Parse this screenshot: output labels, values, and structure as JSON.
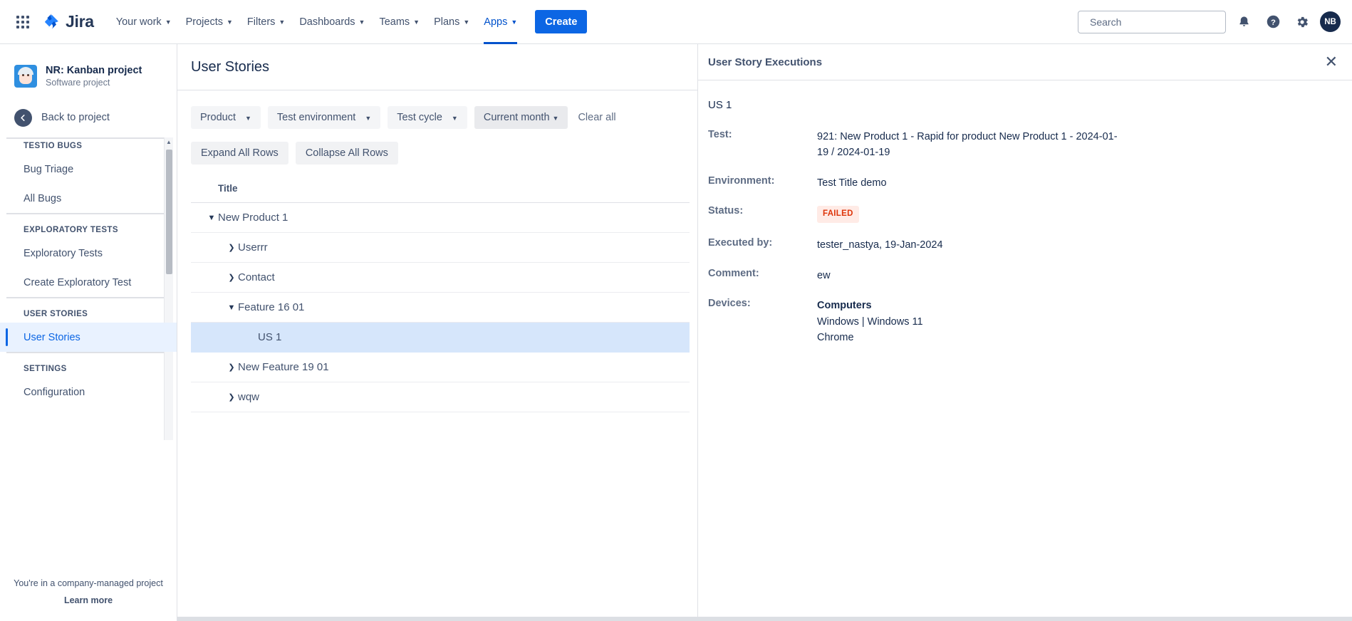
{
  "topnav": {
    "brand": "Jira",
    "app_switcher_icon": "grid-apps-icon",
    "items": [
      {
        "label": "Your work",
        "active": false
      },
      {
        "label": "Projects",
        "active": false
      },
      {
        "label": "Filters",
        "active": false
      },
      {
        "label": "Dashboards",
        "active": false
      },
      {
        "label": "Teams",
        "active": false
      },
      {
        "label": "Plans",
        "active": false
      },
      {
        "label": "Apps",
        "active": true
      }
    ],
    "create_label": "Create",
    "search_placeholder": "Search",
    "search_value": "",
    "icons": [
      "search-icon",
      "notifications-icon",
      "help-icon",
      "settings-icon"
    ],
    "avatar_initials": "NB",
    "accent_color": "#0052cc",
    "create_color": "#0c66e4"
  },
  "sidebar": {
    "project_name": "NR: Kanban project",
    "project_type": "Software project",
    "back_label": "Back to project",
    "sections": [
      {
        "title": "TESTIO BUGS",
        "clipped": true,
        "items": [
          {
            "label": "Bug Triage",
            "selected": false
          },
          {
            "label": "All Bugs",
            "selected": false
          }
        ]
      },
      {
        "title": "EXPLORATORY TESTS",
        "clipped": false,
        "items": [
          {
            "label": "Exploratory Tests",
            "selected": false
          },
          {
            "label": "Create Exploratory Test",
            "selected": false
          }
        ]
      },
      {
        "title": "USER STORIES",
        "clipped": false,
        "items": [
          {
            "label": "User Stories",
            "selected": true
          }
        ]
      },
      {
        "title": "SETTINGS",
        "clipped": false,
        "items": [
          {
            "label": "Configuration",
            "selected": false
          }
        ]
      }
    ],
    "footer_line1": "You're in a company-managed project",
    "footer_line2": "Learn more"
  },
  "main": {
    "page_title": "User Stories",
    "filters": [
      {
        "label": "Product",
        "emphasized": false
      },
      {
        "label": "Test environment",
        "emphasized": false
      },
      {
        "label": "Test cycle",
        "emphasized": false
      },
      {
        "label": "Current month",
        "emphasized": true
      }
    ],
    "clear_all_label": "Clear all",
    "expand_label": "Expand All Rows",
    "collapse_label": "Collapse All Rows",
    "tree_column_header": "Title",
    "tree_rows": [
      {
        "label": "New Product 1",
        "level": 0,
        "twisty": "expanded",
        "selected": false
      },
      {
        "label": "Userrr",
        "level": 1,
        "twisty": "collapsed",
        "selected": false
      },
      {
        "label": "Contact",
        "level": 1,
        "twisty": "collapsed",
        "selected": false
      },
      {
        "label": "Feature 16 01",
        "level": 1,
        "twisty": "expanded",
        "selected": false
      },
      {
        "label": "US 1",
        "level": 2,
        "twisty": "none",
        "selected": true
      },
      {
        "label": "New Feature 19 01",
        "level": 1,
        "twisty": "collapsed",
        "selected": false
      },
      {
        "label": "wqw",
        "level": 1,
        "twisty": "collapsed",
        "selected": false
      }
    ]
  },
  "panel": {
    "title": "User Story Executions",
    "close_icon": "close-icon",
    "story_label": "US 1",
    "fields": [
      {
        "key": "Test:",
        "value": "921: New Product 1 - Rapid for product New Product 1 - 2024-01-19 / 2024-01-19",
        "type": "text"
      },
      {
        "key": "Environment:",
        "value": "Test Title demo",
        "type": "text"
      },
      {
        "key": "Status:",
        "value": "FAILED",
        "type": "badge"
      },
      {
        "key": "Executed by:",
        "value": "tester_nastya, 19-Jan-2024",
        "type": "text"
      },
      {
        "key": "Comment:",
        "value": "ew",
        "type": "text"
      },
      {
        "key": "Devices:",
        "value": "",
        "type": "devices",
        "device_title": "Computers",
        "device_os": "Windows | Windows 11",
        "device_browser": "Chrome"
      }
    ],
    "status_color": "#de350b",
    "status_bg": "#ffebe6"
  }
}
